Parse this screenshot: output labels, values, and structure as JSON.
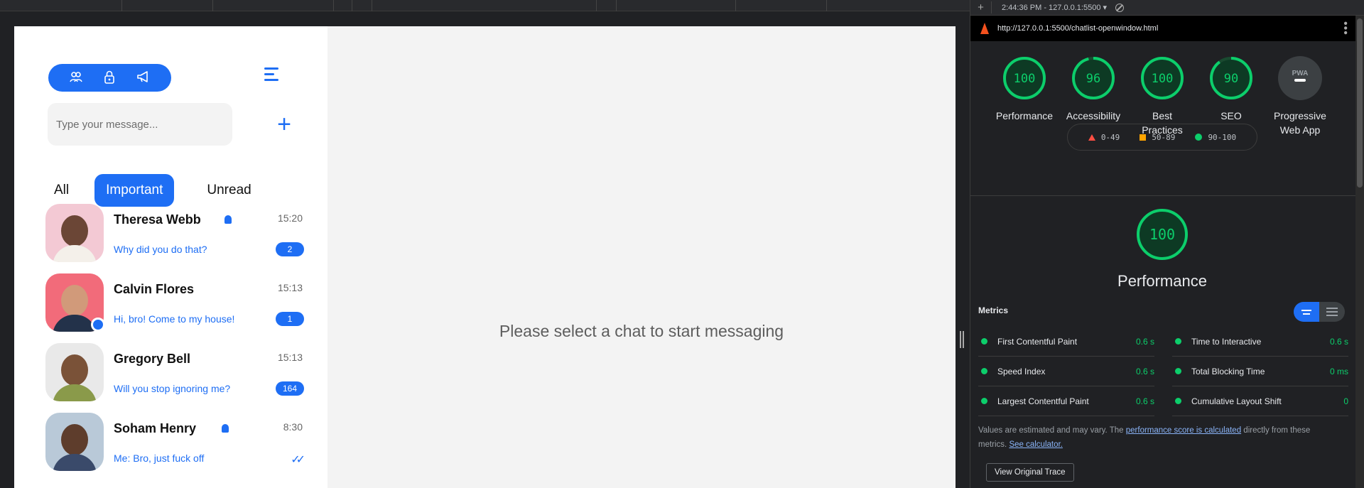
{
  "chat_app": {
    "search": {
      "placeholder": "Type your message..."
    },
    "filters": {
      "all": "All",
      "important": "Important",
      "unread": "Unread"
    },
    "chats": [
      {
        "name": "Theresa Webb",
        "time": "15:20",
        "preview": "Why did you do that?",
        "badge": "2",
        "important": true,
        "online": false
      },
      {
        "name": "Calvin Flores",
        "time": "15:13",
        "preview": "Hi, bro! Come to my house!",
        "badge": "1",
        "important": false,
        "online": true
      },
      {
        "name": "Gregory Bell",
        "time": "15:13",
        "preview": "Will you stop ignoring me?",
        "badge": "164",
        "important": false,
        "online": false
      },
      {
        "name": "Soham Henry",
        "time": "8:30",
        "preview": "Me: Bro, just fuck off",
        "badge": "",
        "important": true,
        "online": false
      }
    ],
    "empty_state": "Please select a chat to start messaging"
  },
  "devtools": {
    "session": "2:44:36 PM - 127.0.0.1:5500",
    "url": "http://127.0.0.1:5500/chatlist-openwindow.html",
    "scores": [
      {
        "value": "100",
        "label": "Performance",
        "fraction": 1.0
      },
      {
        "value": "96",
        "label": "Accessibility",
        "fraction": 0.96
      },
      {
        "value": "100",
        "label": "Best Practices",
        "fraction": 1.0
      },
      {
        "value": "90",
        "label": "SEO",
        "fraction": 0.9
      },
      {
        "value": "PWA",
        "label": "Progressive Web App",
        "fraction": 0
      }
    ],
    "legend": {
      "fail": "0-49",
      "average": "50-89",
      "pass": "90-100"
    },
    "performance": {
      "score": "100",
      "label": "Performance"
    },
    "metrics_title": "Metrics",
    "metrics": [
      {
        "name": "First Contentful Paint",
        "value": "0.6 s"
      },
      {
        "name": "Time to Interactive",
        "value": "0.6 s"
      },
      {
        "name": "Speed Index",
        "value": "0.6 s"
      },
      {
        "name": "Total Blocking Time",
        "value": "0 ms"
      },
      {
        "name": "Largest Contentful Paint",
        "value": "0.6 s"
      },
      {
        "name": "Cumulative Layout Shift",
        "value": "0"
      }
    ],
    "note": {
      "prefix": "Values are estimated and may vary. The ",
      "link1": "performance score is calculated",
      "middle": " directly from these metrics. ",
      "link2": "See calculator."
    },
    "trace_button": "View Original Trace"
  },
  "colors": {
    "accent": "#1e6ef4",
    "pass": "#0cce6b",
    "average": "#ffa400",
    "fail": "#ff4e42"
  }
}
